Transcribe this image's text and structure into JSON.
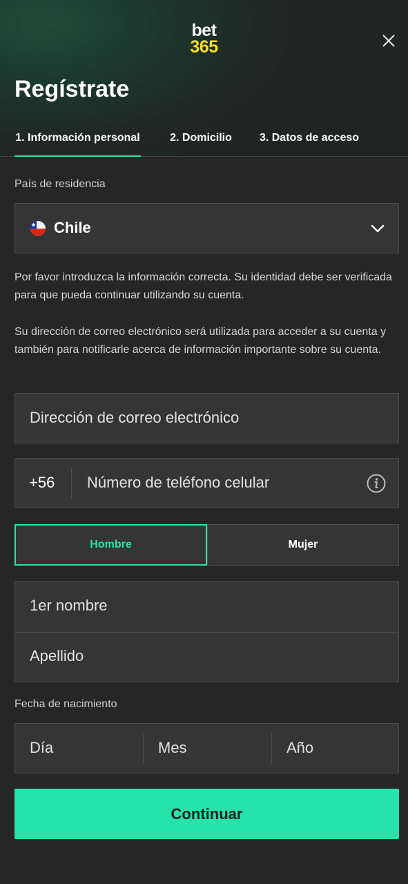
{
  "header": {
    "logo_line1": "bet",
    "logo_line2": "365",
    "title": "Regístrate"
  },
  "tabs": [
    {
      "label": "1.  Información personal",
      "active": true
    },
    {
      "label": "2.  Domicilio",
      "active": false
    },
    {
      "label": "3.  Datos de acceso",
      "active": false
    }
  ],
  "country": {
    "label": "País de residencia",
    "value": "Chile",
    "flag_icon": "chile-flag-icon"
  },
  "info_text_1": "Por favor introduzca la información correcta. Su identidad debe ser verificada para que pueda continuar utilizando su cuenta.",
  "info_text_2": "Su dirección de correo electrónico será utilizada para acceder a su cuenta y también para notificarle acerca de información importante sobre su cuenta.",
  "email": {
    "placeholder": "Dirección de correo electrónico"
  },
  "phone": {
    "prefix": "+56",
    "placeholder": "Número de teléfono celular"
  },
  "gender": {
    "male": "Hombre",
    "female": "Mujer",
    "selected": "Hombre"
  },
  "name": {
    "first_placeholder": "1er nombre",
    "last_placeholder": "Apellido"
  },
  "birth": {
    "label": "Fecha de nacimiento",
    "day": "Día",
    "month": "Mes",
    "year": "Año"
  },
  "continue_label": "Continuar",
  "colors": {
    "accent": "#26e3a9",
    "logo_yellow": "#ffdf1b",
    "background": "#262626",
    "field_background": "#353535"
  }
}
